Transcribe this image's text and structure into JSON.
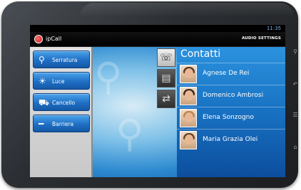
{
  "status": {
    "time": "11:35"
  },
  "app": {
    "title": "ipCall",
    "audio_settings": "AUDIO SETTINGS"
  },
  "menu": [
    {
      "label": "Serratura",
      "icon": "key-icon"
    },
    {
      "label": "Luce",
      "icon": "light-icon"
    },
    {
      "label": "Cancello",
      "icon": "car-icon"
    },
    {
      "label": "Barriera",
      "icon": "barrier-icon"
    }
  ],
  "side_icons": [
    "intercom-icon",
    "door-icon",
    "arrows-icon"
  ],
  "contacts": {
    "title": "Contatti",
    "items": [
      {
        "name": "Agnese De Rei"
      },
      {
        "name": "Domenico Ambrosi"
      },
      {
        "name": "Elena Sonzogno"
      },
      {
        "name": "Maria Grazia Olei"
      }
    ]
  }
}
